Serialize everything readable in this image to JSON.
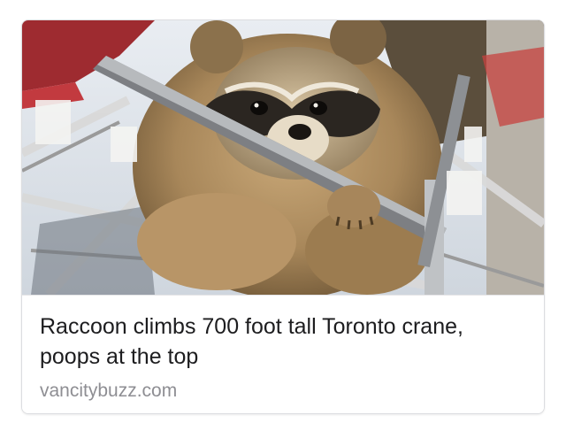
{
  "link_preview": {
    "image_subject": "raccoon-photo",
    "headline": "Raccoon climbs 700 foot tall Toronto crane, poops at the top",
    "domain": "vancitybuzz.com"
  },
  "colors": {
    "headline_text": "#1d1d1f",
    "domain_text": "#8e8e93",
    "card_border": "#dcdde0"
  }
}
